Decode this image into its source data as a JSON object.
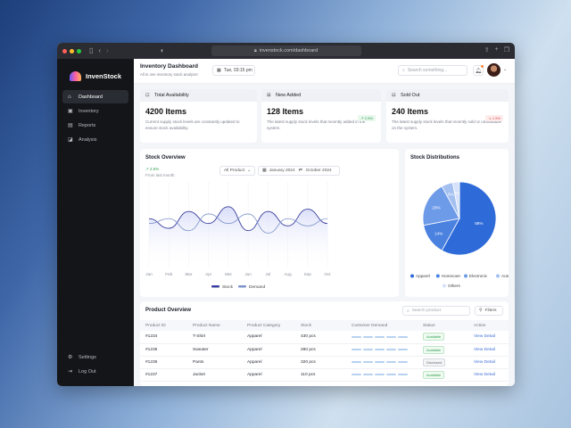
{
  "browser": {
    "url": "invenstock.com/dashboard"
  },
  "app": {
    "name": "InvenStock"
  },
  "sidebar": {
    "items": [
      {
        "label": "Dashboard",
        "icon": "home-icon"
      },
      {
        "label": "Inventory",
        "icon": "box-icon"
      },
      {
        "label": "Reports",
        "icon": "document-icon"
      },
      {
        "label": "Analysis",
        "icon": "chart-icon"
      }
    ],
    "bottom": [
      {
        "label": "Settings",
        "icon": "gear-icon"
      },
      {
        "label": "Log Out",
        "icon": "logout-icon"
      }
    ]
  },
  "header": {
    "title": "Inventory Dashboard",
    "subtitle": "All in one inventory stock analyzer",
    "datetime": "Tue, 03:15 pm",
    "search_placeholder": "Search something..."
  },
  "stats": [
    {
      "title": "Total Availability",
      "value": "4200 Items",
      "desc": "Current supply stock levels are constantly updated to ensure stock availability.",
      "badge": "",
      "badge_color": ""
    },
    {
      "title": "New Added",
      "value": "128 Items",
      "desc": "The latest supply stock levels that recently added in the system.",
      "badge": "↗ 2.5%",
      "badge_color": "#2f9e4e"
    },
    {
      "title": "Sold Out",
      "value": "240 Items",
      "desc": "The latest supply stock levels that recently sold or unavailable on the system.",
      "badge": "↘ 1.5%",
      "badge_color": "#e04848"
    }
  ],
  "overview": {
    "title": "Stock Overview",
    "delta": "↗ 2.5%",
    "delta_note": "From last month",
    "product_filter": "All Product",
    "date_from": "January 2024",
    "date_to": "October 2024"
  },
  "distribution": {
    "title": "Stock Distributions"
  },
  "chart_data": [
    {
      "type": "line",
      "categories": [
        "Jan",
        "Feb",
        "Mar",
        "Apr",
        "Mei",
        "Jun",
        "Jul",
        "Aug",
        "Sep",
        "Oct"
      ],
      "series": [
        {
          "name": "Stock",
          "color": "#3b3f9e",
          "values": [
            60,
            56,
            63,
            58,
            65,
            55,
            63,
            57,
            64,
            58
          ]
        },
        {
          "name": "Demand",
          "color": "#7c93c9",
          "values": [
            58,
            60,
            55,
            62,
            58,
            62,
            54,
            60,
            57,
            60
          ]
        }
      ]
    },
    {
      "type": "pie",
      "categories": [
        "Apparel",
        "Homecare",
        "Electronic",
        "Automotive",
        "Others"
      ],
      "values": [
        58,
        14,
        20,
        5,
        3
      ],
      "colors": [
        "#2f6bd8",
        "#4b82e0",
        "#6e9be8",
        "#a3c0f1",
        "#d5e2fa"
      ]
    }
  ],
  "products": {
    "title": "Product Overview",
    "search_placeholder": "Search product",
    "filter_label": "Filters",
    "columns": [
      "Product ID",
      "Product Name",
      "Product Category",
      "Stock",
      "Customer Demand",
      "Status",
      "Action"
    ],
    "rows": [
      {
        "id": "#1234",
        "name": "T-Shirt",
        "category": "Apparel",
        "stock": "430 pcs",
        "status": "Available",
        "action": "View Detail"
      },
      {
        "id": "#1235",
        "name": "Sweater",
        "category": "Apparel",
        "stock": "280 pcs",
        "status": "Available",
        "action": "View Detail"
      },
      {
        "id": "#1236",
        "name": "Pants",
        "category": "Apparel",
        "stock": "320 pcs",
        "status": "Disclosed",
        "action": "View Detail"
      },
      {
        "id": "#1237",
        "name": "Jacket",
        "category": "Apparel",
        "stock": "110 pcs",
        "status": "Available",
        "action": "View Detail"
      }
    ]
  }
}
